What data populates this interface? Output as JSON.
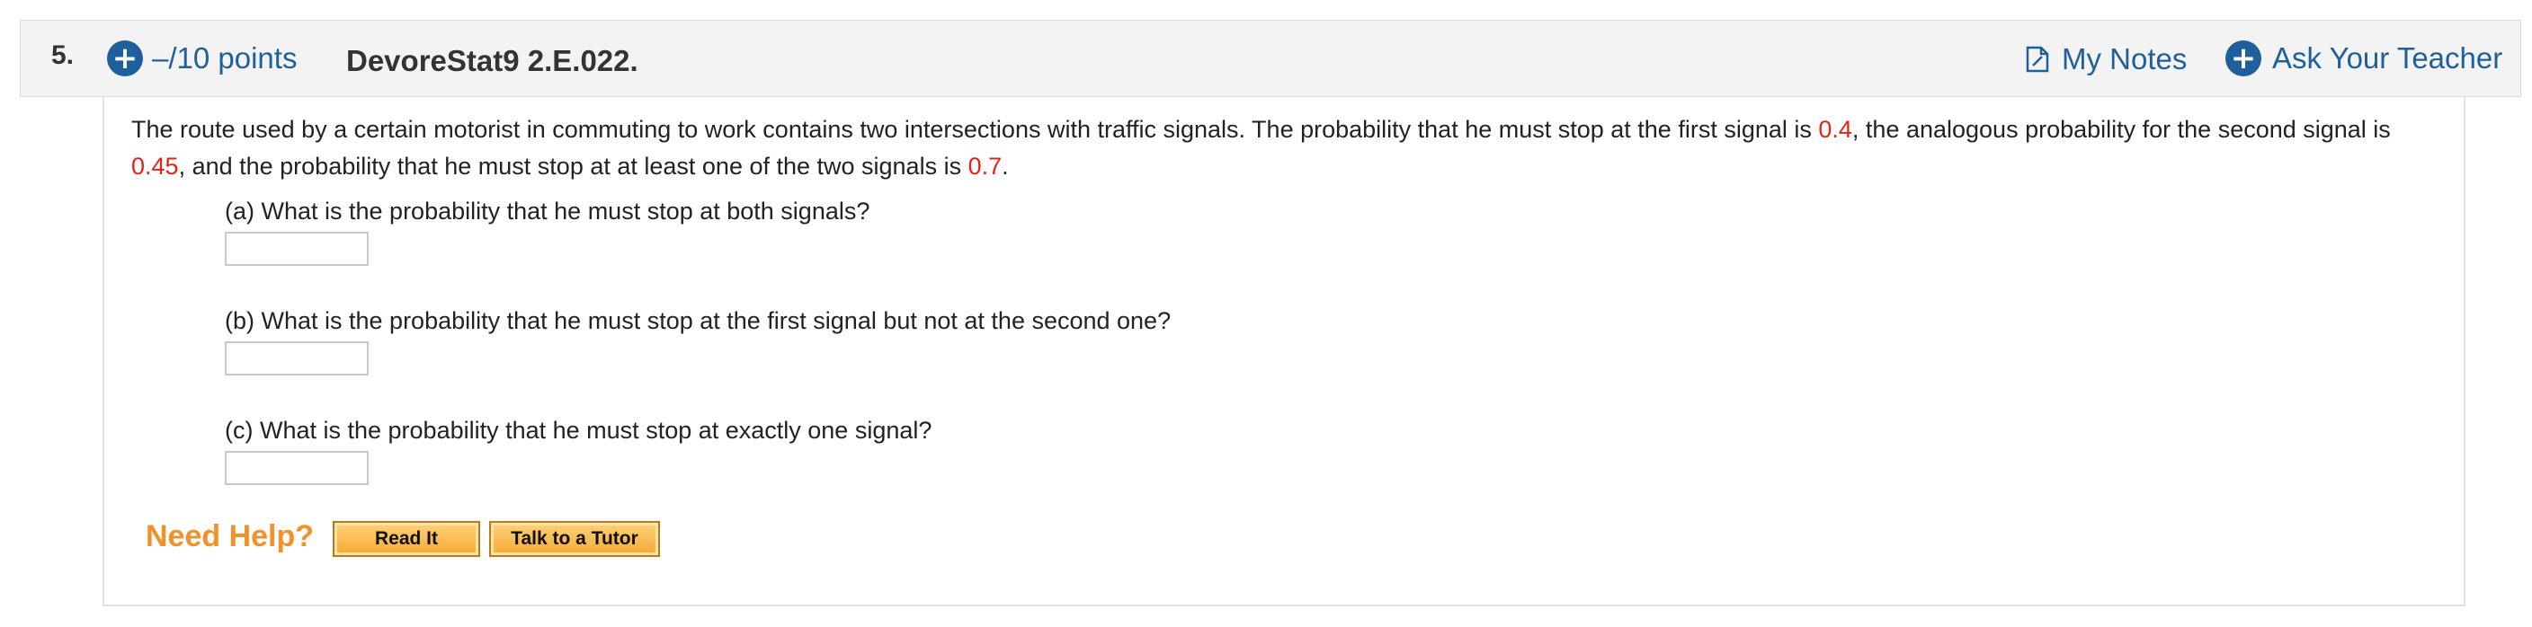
{
  "header": {
    "number": "5.",
    "points": "–/10 points",
    "title": "DevoreStat9 2.E.022.",
    "my_notes": "My Notes",
    "ask_teacher": "Ask Your Teacher"
  },
  "question": {
    "stem_1": "The route used by a certain motorist in commuting to work contains two intersections with traffic signals. The probability that he must stop at the first signal is ",
    "p1": "0.4",
    "stem_2": ", the analogous probability for the second signal is ",
    "p2": "0.45",
    "stem_3": ", and the probability that he must stop at at least one of the two signals is ",
    "p3": "0.7",
    "stem_4": "."
  },
  "parts": [
    {
      "label": "(a) What is the probability that he must stop at both signals?",
      "value": ""
    },
    {
      "label": "(b) What is the probability that he must stop at the first signal but not at the second one?",
      "value": ""
    },
    {
      "label": "(c) What is the probability that he must stop at exactly one signal?",
      "value": ""
    }
  ],
  "help": {
    "label": "Need Help?",
    "read_it": "Read It",
    "tutor": "Talk to a Tutor"
  },
  "colors": {
    "link": "#1f5f9b",
    "value_red": "#e2231a",
    "help_orange": "#f0922b"
  }
}
